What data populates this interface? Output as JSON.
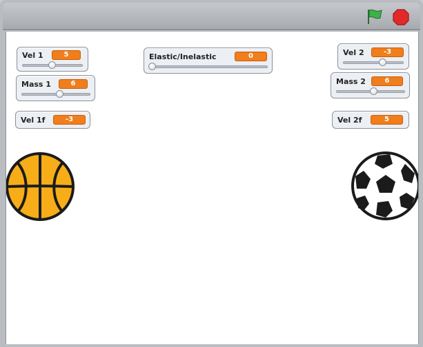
{
  "toolbar": {
    "green_flag": "green-flag-icon",
    "stop": "stop-sign-icon"
  },
  "monitors": {
    "vel1": {
      "label": "Vel 1",
      "value": "5",
      "slider": 0.5
    },
    "mass1": {
      "label": "Mass 1",
      "value": "6",
      "slider": 0.6
    },
    "elastic": {
      "label": "Elastic/Inelastic",
      "value": "0",
      "slider": 0.0
    },
    "vel2": {
      "label": "Vel 2",
      "value": "-3",
      "slider": 0.6
    },
    "mass2": {
      "label": "Mass 2",
      "value": "6",
      "slider": 0.6
    },
    "vel1f": {
      "label": "Vel 1f",
      "value": "-3"
    },
    "vel2f": {
      "label": "Vel 2f",
      "value": "5"
    }
  },
  "sprites": {
    "left": "basketball",
    "right": "soccer-ball"
  },
  "colors": {
    "value_bg": "#f07e1c",
    "basketball": "#f6ad17",
    "flag": "#3fb14a",
    "stop": "#e2292a"
  }
}
